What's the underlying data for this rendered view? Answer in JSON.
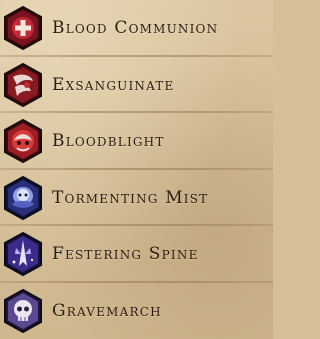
{
  "abilities": [
    {
      "label": "Blood Communion",
      "icon": "blood-communion-icon",
      "color": "#b01f2a"
    },
    {
      "label": "Exsanguinate",
      "icon": "exsanguinate-icon",
      "color": "#b01f2a"
    },
    {
      "label": "Bloodblight",
      "icon": "bloodblight-icon",
      "color": "#b01f2a"
    },
    {
      "label": "Tormenting Mist",
      "icon": "tormenting-mist-icon",
      "color": "#3a3f9e"
    },
    {
      "label": "Festering Spine",
      "icon": "festering-spine-icon",
      "color": "#4a3aa0"
    },
    {
      "label": "Gravemarch",
      "icon": "gravemarch-icon",
      "color": "#6d5aa8"
    }
  ],
  "colors": {
    "parchment": "#d6c09a",
    "text": "#2a1c12",
    "blood_red": "#b01f2a",
    "shadow_purple": "#4a3aa0"
  }
}
